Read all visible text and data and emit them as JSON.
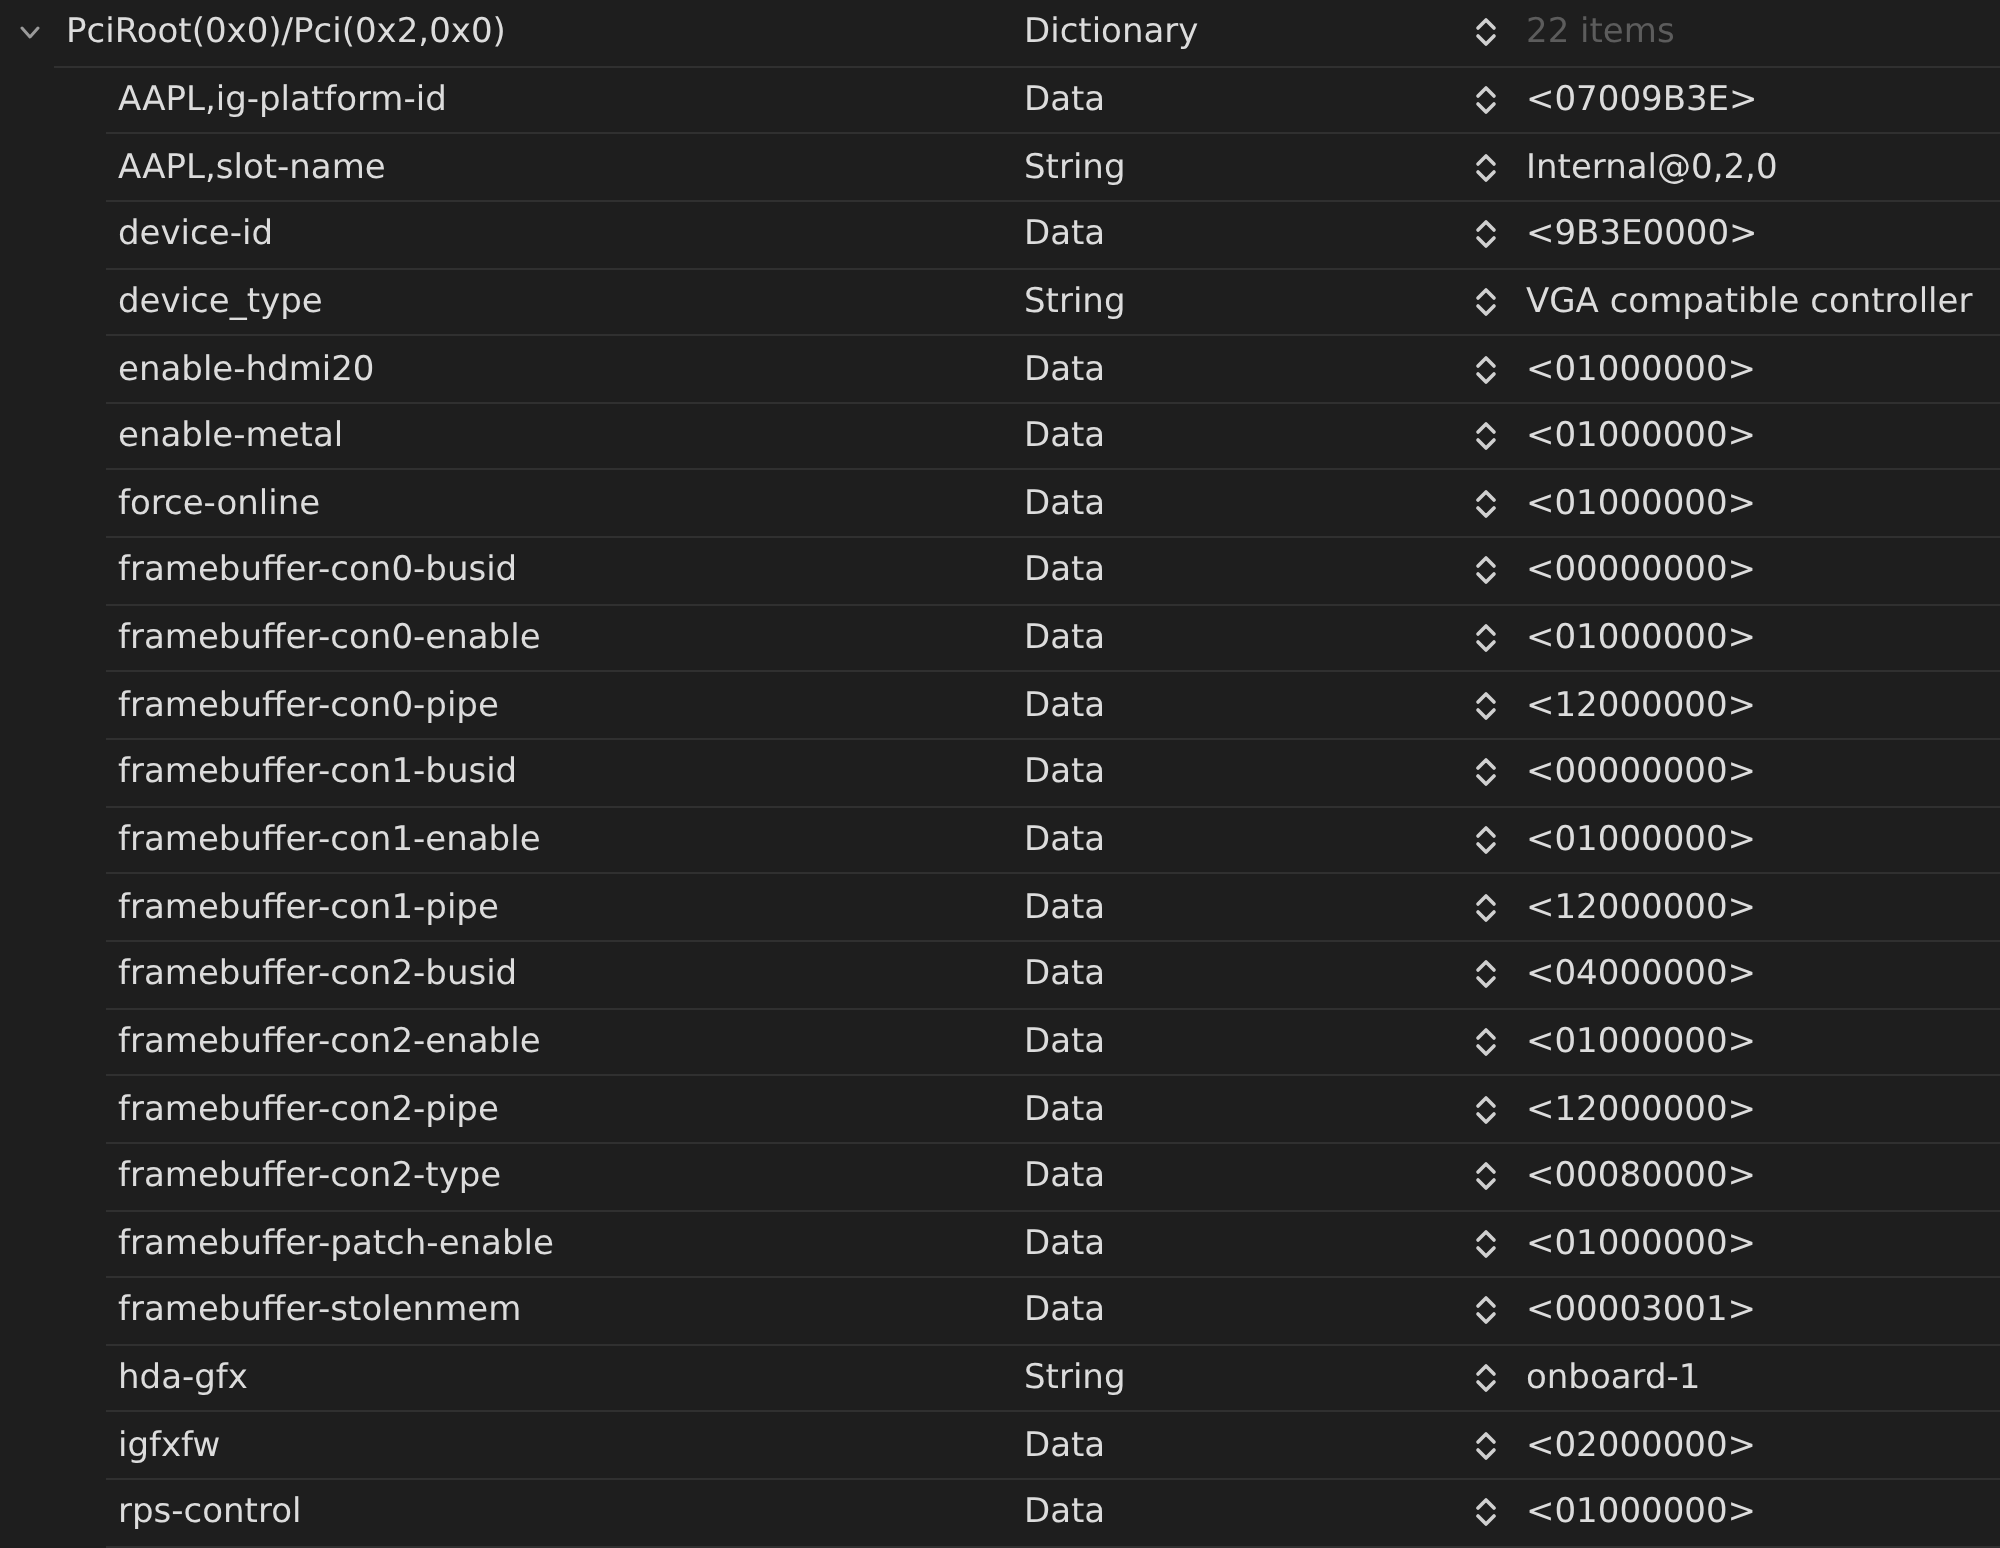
{
  "tree": {
    "root": {
      "key": "PciRoot(0x0)/Pci(0x2,0x0)",
      "type": "Dictionary",
      "value": "22 items",
      "expanded": true,
      "children": [
        {
          "key": "AAPL,ig-platform-id",
          "type": "Data",
          "value": "<07009B3E>"
        },
        {
          "key": "AAPL,slot-name",
          "type": "String",
          "value": "Internal@0,2,0"
        },
        {
          "key": "device-id",
          "type": "Data",
          "value": "<9B3E0000>"
        },
        {
          "key": "device_type",
          "type": "String",
          "value": "VGA compatible controller"
        },
        {
          "key": "enable-hdmi20",
          "type": "Data",
          "value": "<01000000>"
        },
        {
          "key": "enable-metal",
          "type": "Data",
          "value": "<01000000>"
        },
        {
          "key": "force-online",
          "type": "Data",
          "value": "<01000000>"
        },
        {
          "key": "framebuffer-con0-busid",
          "type": "Data",
          "value": "<00000000>"
        },
        {
          "key": "framebuffer-con0-enable",
          "type": "Data",
          "value": "<01000000>"
        },
        {
          "key": "framebuffer-con0-pipe",
          "type": "Data",
          "value": "<12000000>"
        },
        {
          "key": "framebuffer-con1-busid",
          "type": "Data",
          "value": "<00000000>"
        },
        {
          "key": "framebuffer-con1-enable",
          "type": "Data",
          "value": "<01000000>"
        },
        {
          "key": "framebuffer-con1-pipe",
          "type": "Data",
          "value": "<12000000>"
        },
        {
          "key": "framebuffer-con2-busid",
          "type": "Data",
          "value": "<04000000>"
        },
        {
          "key": "framebuffer-con2-enable",
          "type": "Data",
          "value": "<01000000>"
        },
        {
          "key": "framebuffer-con2-pipe",
          "type": "Data",
          "value": "<12000000>"
        },
        {
          "key": "framebuffer-con2-type",
          "type": "Data",
          "value": "<00080000>"
        },
        {
          "key": "framebuffer-patch-enable",
          "type": "Data",
          "value": "<01000000>"
        },
        {
          "key": "framebuffer-stolenmem",
          "type": "Data",
          "value": "<00003001>"
        },
        {
          "key": "hda-gfx",
          "type": "String",
          "value": "onboard-1"
        },
        {
          "key": "igfxfw",
          "type": "Data",
          "value": "<02000000>"
        },
        {
          "key": "rps-control",
          "type": "Data",
          "value": "<01000000>"
        }
      ]
    }
  }
}
